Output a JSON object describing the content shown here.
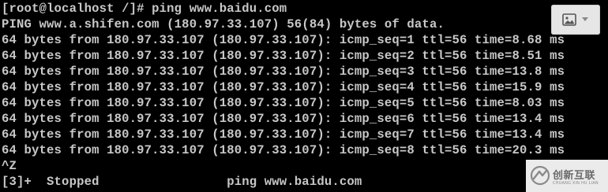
{
  "terminal": {
    "lines": [
      "[root@localhost /]# ping www.baidu.com",
      "PING www.a.shifen.com (180.97.33.107) 56(84) bytes of data.",
      "64 bytes from 180.97.33.107 (180.97.33.107): icmp_seq=1 ttl=56 time=8.68 ms",
      "64 bytes from 180.97.33.107 (180.97.33.107): icmp_seq=2 ttl=56 time=8.51 ms",
      "64 bytes from 180.97.33.107 (180.97.33.107): icmp_seq=3 ttl=56 time=13.8 ms",
      "64 bytes from 180.97.33.107 (180.97.33.107): icmp_seq=4 ttl=56 time=15.9 ms",
      "64 bytes from 180.97.33.107 (180.97.33.107): icmp_seq=5 ttl=56 time=8.03 ms",
      "64 bytes from 180.97.33.107 (180.97.33.107): icmp_seq=6 ttl=56 time=13.4 ms",
      "64 bytes from 180.97.33.107 (180.97.33.107): icmp_seq=7 ttl=56 time=13.4 ms",
      "64 bytes from 180.97.33.107 (180.97.33.107): icmp_seq=8 ttl=56 time=20.3 ms",
      "^Z",
      "[3]+  Stopped                 ping www.baidu.com"
    ]
  },
  "image_tool": {
    "icon": "image-icon",
    "caret_icon": "chevron-down-icon"
  },
  "watermark": {
    "brand": "创新互联",
    "subtitle": "CHUANG XIN HU LIAN",
    "logo_icon": "brand-logo-icon"
  },
  "colors": {
    "background": "#000000",
    "text": "#c8c8c8",
    "button_bg": "#e6e6e6",
    "watermark_text": "#6a6a6a"
  }
}
